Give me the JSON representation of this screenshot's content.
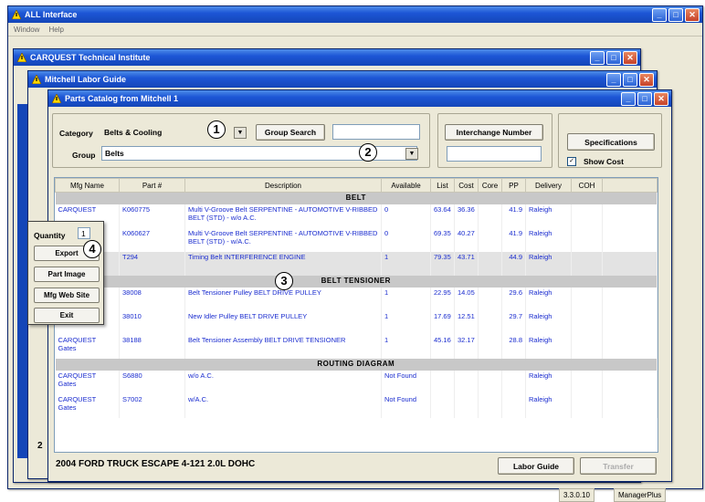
{
  "main_window": {
    "title": "ALL Interface",
    "menu": [
      "Window",
      "Help"
    ]
  },
  "cti_window": {
    "title": "CARQUEST Technical Institute"
  },
  "labor_window": {
    "title": "Mitchell Labor Guide"
  },
  "parts_window": {
    "title": "Parts Catalog from Mitchell 1",
    "category_label": "Category",
    "category_value": "Belts & Cooling",
    "group_label": "Group",
    "group_value": "Belts",
    "group_search_button": "Group Search",
    "group_search_input": "",
    "interchange_button": "Interchange Number",
    "interchange_input": "",
    "specifications_button": "Specifications",
    "show_cost_label": "Show Cost",
    "show_cost_checked": true,
    "vehicle": "2004 FORD TRUCK ESCAPE 4-121  2.0L DOHC",
    "labor_guide_button": "Labor Guide",
    "transfer_button": "Transfer"
  },
  "table": {
    "columns": [
      "Mfg Name",
      "Part #",
      "Description",
      "Available",
      "List",
      "Cost",
      "Core",
      "PP",
      "Delivery",
      "COH"
    ],
    "sections": [
      {
        "name": "BELT",
        "rows": [
          {
            "mfg": "CARQUEST",
            "part": "K060775",
            "desc": "Multi V-Groove Belt SERPENTINE - AUTOMOTIVE V-RIBBED BELT (STD) - w/o A.C.",
            "available": "0",
            "list": "63.64",
            "cost": "36.36",
            "core": "",
            "pp": "41.9",
            "delivery": "Raleigh",
            "coh": ""
          },
          {
            "mfg": "",
            "part": "K060627",
            "desc": "Multi V-Groove Belt SERPENTINE - AUTOMOTIVE V-RIBBED BELT (STD) - w/A.C.",
            "available": "0",
            "list": "69.35",
            "cost": "40.27",
            "core": "",
            "pp": "41.9",
            "delivery": "Raleigh",
            "coh": ""
          },
          {
            "mfg": "",
            "part": "T294",
            "desc": "Timing Belt INTERFERENCE ENGINE",
            "available": "1",
            "list": "79.35",
            "cost": "43.71",
            "core": "",
            "pp": "44.9",
            "delivery": "Raleigh",
            "coh": ""
          }
        ]
      },
      {
        "name": "BELT TENSIONER",
        "rows": [
          {
            "mfg": "",
            "part": "38008",
            "desc": "Belt Tensioner Pulley BELT DRIVE PULLEY",
            "available": "1",
            "list": "22.95",
            "cost": "14.05",
            "core": "",
            "pp": "29.6",
            "delivery": "Raleigh",
            "coh": ""
          },
          {
            "mfg": "",
            "part": "38010",
            "desc": "New Idler Pulley BELT DRIVE PULLEY",
            "available": "1",
            "list": "17.69",
            "cost": "12.51",
            "core": "",
            "pp": "29.7",
            "delivery": "Raleigh",
            "coh": ""
          },
          {
            "mfg": "CARQUEST Gates",
            "part": "38188",
            "desc": "Belt Tensioner Assembly BELT DRIVE TENSIONER",
            "available": "1",
            "list": "45.16",
            "cost": "32.17",
            "core": "",
            "pp": "28.8",
            "delivery": "Raleigh",
            "coh": ""
          }
        ]
      },
      {
        "name": "ROUTING DIAGRAM",
        "rows": [
          {
            "mfg": "CARQUEST Gates",
            "part": "S6880",
            "desc": "w/o A.C.",
            "available": "Not Found",
            "list": "",
            "cost": "",
            "core": "",
            "pp": "",
            "delivery": "Raleigh",
            "coh": ""
          },
          {
            "mfg": "CARQUEST Gates",
            "part": "S7002",
            "desc": "w/A.C.",
            "available": "Not Found",
            "list": "",
            "cost": "",
            "core": "",
            "pp": "",
            "delivery": "Raleigh",
            "coh": ""
          }
        ]
      }
    ]
  },
  "popup": {
    "quantity_label": "Quantity",
    "quantity_value": "1",
    "buttons": [
      "Export",
      "Part Image",
      "Mfg Web Site",
      "Exit"
    ]
  },
  "callouts": [
    "1",
    "2",
    "3",
    "4"
  ],
  "side_digit": "2",
  "status_bar": {
    "version": "3.3.0.10",
    "user": "ManagerPlus"
  },
  "colors": {
    "title_blue": "#1d56d6",
    "link_blue": "#1a2ccf",
    "section_gray": "#c8c8c8"
  }
}
